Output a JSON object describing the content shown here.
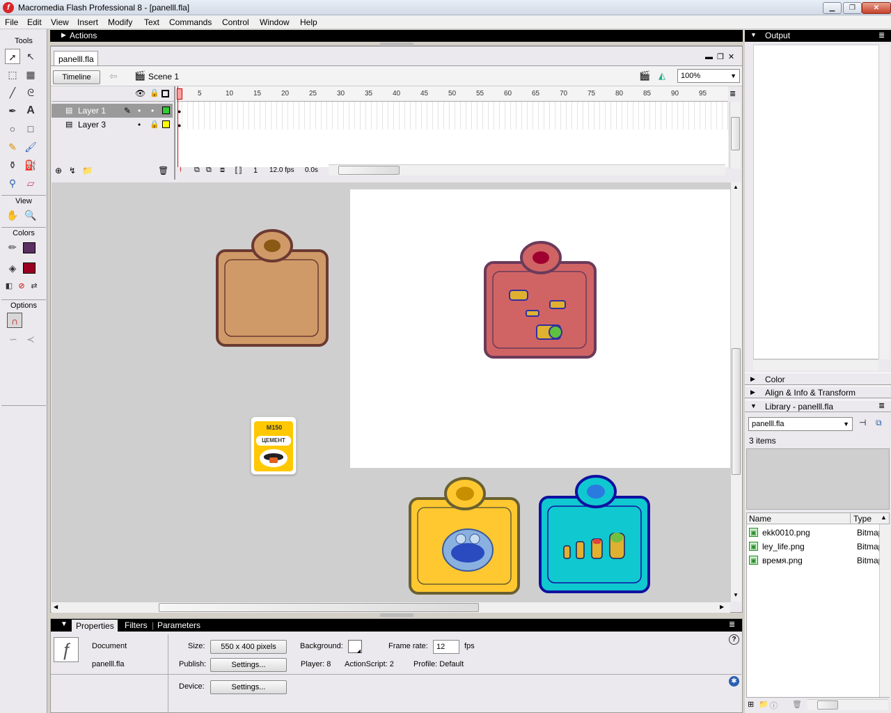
{
  "window": {
    "title": "Macromedia Flash Professional 8 - [panelll.fla]",
    "app_icon": "f"
  },
  "menu": [
    "File",
    "Edit",
    "View",
    "Insert",
    "Modify",
    "Text",
    "Commands",
    "Control",
    "Window",
    "Help"
  ],
  "tools": {
    "title": "Tools",
    "view_label": "View",
    "colors_label": "Colors",
    "options_label": "Options",
    "stroke_color": "#5a3060",
    "fill_color": "#990022"
  },
  "actions": {
    "label": "Actions"
  },
  "document": {
    "tab": "panelll.fla",
    "timeline_btn": "Timeline",
    "scene": "Scene 1",
    "zoom": "100%"
  },
  "timeline": {
    "layers": [
      {
        "name": "Layer 1",
        "color": "#33cc33"
      },
      {
        "name": "Layer 3",
        "color": "#ffff00"
      }
    ],
    "ruler": [
      "5",
      "10",
      "15",
      "20",
      "25",
      "30",
      "35",
      "40",
      "45",
      "50",
      "55",
      "60",
      "65",
      "70",
      "75",
      "80",
      "85",
      "90",
      "95"
    ],
    "current_frame": "1",
    "fps": "12.0 fps",
    "time": "0.0s"
  },
  "stage_items": {
    "cement_top": "М150",
    "cement_mid": "ЦЕМЕНТ"
  },
  "right": {
    "output": "Output",
    "color": "Color",
    "align": "Align & Info & Transform",
    "library": "Library - panelll.fla",
    "lib_select": "panelll.fla",
    "items_count": "3 items",
    "col_name": "Name",
    "col_type": "Type",
    "items": [
      {
        "name": "ekk0010.png",
        "type": "Bitmap"
      },
      {
        "name": "ley_life.png",
        "type": "Bitmap"
      },
      {
        "name": "время.png",
        "type": "Bitmap"
      }
    ]
  },
  "properties": {
    "tabs": [
      "Properties",
      "Filters",
      "Parameters"
    ],
    "doc_label": "Document",
    "doc_name": "panelll.fla",
    "size_label": "Size:",
    "size_value": "550 x 400 pixels",
    "background_label": "Background:",
    "framerate_label": "Frame rate:",
    "framerate_value": "12",
    "fps_label": "fps",
    "publish_label": "Publish:",
    "settings": "Settings...",
    "player": "Player: 8",
    "actionscript": "ActionScript:  2",
    "profile": "Profile:  Default",
    "device_label": "Device:"
  }
}
